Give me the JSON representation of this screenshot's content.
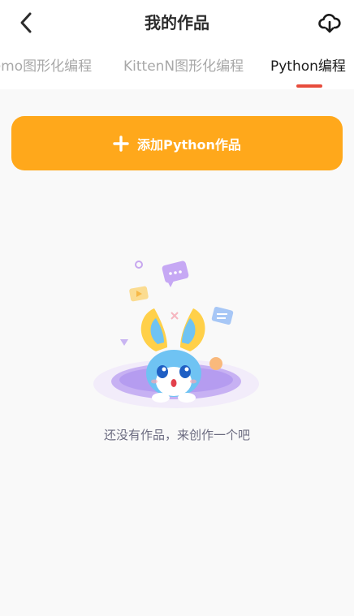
{
  "header": {
    "title": "我的作品",
    "back_icon": "chevron-left-icon",
    "cloud_icon": "cloud-download-icon"
  },
  "tabs": [
    {
      "label": "Nemo图形化编程",
      "active": false
    },
    {
      "label": "KittenN图形化编程",
      "active": false
    },
    {
      "label": "Python编程",
      "active": true
    }
  ],
  "add_button": {
    "label": "添加Python作品",
    "icon": "plus-icon"
  },
  "empty_state": {
    "message": "还没有作品，来创作一个吧"
  },
  "colors": {
    "accent": "#ffa81b",
    "tab_indicator": "#e74c3c",
    "background": "#f9f9f9"
  }
}
